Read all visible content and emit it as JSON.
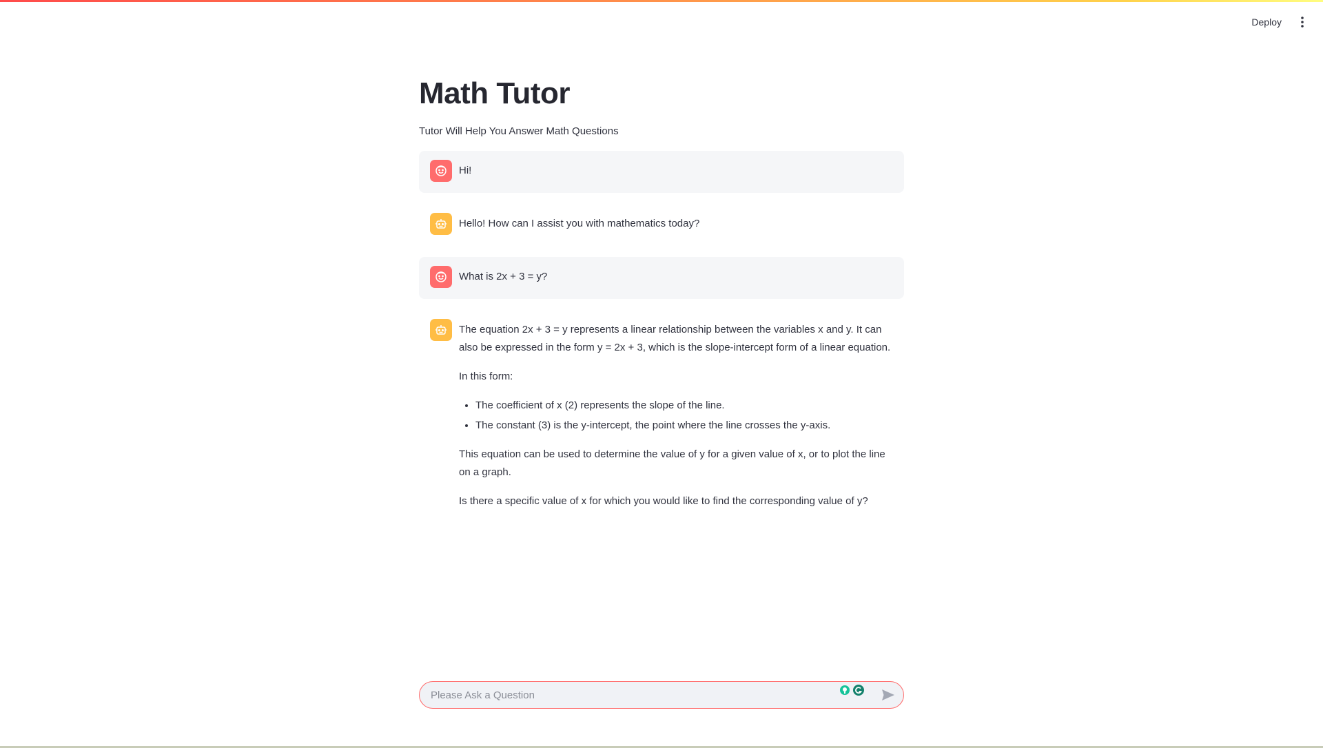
{
  "header": {
    "deploy_label": "Deploy",
    "menu_icon": "vertical-ellipsis-icon"
  },
  "page": {
    "title": "Math Tutor",
    "subtitle": "Tutor Will Help You Answer Math Questions"
  },
  "messages": [
    {
      "role": "user",
      "avatar_icon": "smiley-face-icon",
      "text": "Hi!"
    },
    {
      "role": "assistant",
      "avatar_icon": "robot-icon",
      "text": "Hello! How can I assist you with mathematics today?"
    },
    {
      "role": "user",
      "avatar_icon": "smiley-face-icon",
      "text": "What is 2x + 3 = y?"
    },
    {
      "role": "assistant",
      "avatar_icon": "robot-icon",
      "paragraph_1": "The equation 2x + 3 = y represents a linear relationship between the variables x and y. It can also be expressed in the form y = 2x + 3, which is the slope-intercept form of a linear equation.",
      "paragraph_2": "In this form:",
      "bullets": [
        "The coefficient of x (2) represents the slope of the line.",
        "The constant (3) is the y-intercept, the point where the line crosses the y-axis."
      ],
      "paragraph_3": "This equation can be used to determine the value of y for a given value of x, or to plot the line on a graph.",
      "paragraph_4": "Is there a specific value of x for which you would like to find the corresponding value of y?"
    }
  ],
  "chat_input": {
    "placeholder": "Please Ask a Question",
    "value": "",
    "send_icon": "send-arrow-icon",
    "extension_icons": [
      "lightbulb-icon",
      "grammarly-icon"
    ]
  },
  "colors": {
    "user_avatar": "#ff6c6c",
    "assistant_avatar": "#ffbd45",
    "input_border": "#ff6c6c",
    "user_message_bg": "#f5f6f8"
  }
}
